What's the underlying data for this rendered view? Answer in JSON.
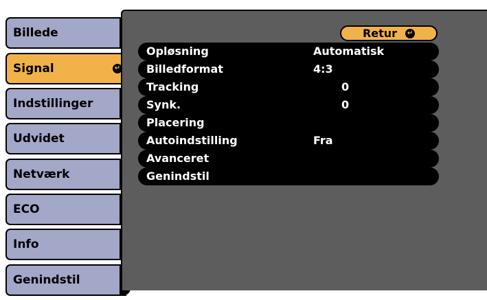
{
  "sidebar": {
    "items": [
      {
        "label": "Billede"
      },
      {
        "label": "Signal"
      },
      {
        "label": "Indstillinger"
      },
      {
        "label": "Udvidet"
      },
      {
        "label": "Netværk"
      },
      {
        "label": "ECO"
      },
      {
        "label": "Info"
      },
      {
        "label": "Genindstil"
      }
    ],
    "active_index": 1
  },
  "panel": {
    "retur_label": "Retur",
    "rows": [
      {
        "label": "Opløsning",
        "value": "Automatisk"
      },
      {
        "label": "Billedformat",
        "value": "4:3"
      },
      {
        "label": "Tracking",
        "value": "0"
      },
      {
        "label": "Synk.",
        "value": "0"
      },
      {
        "label": "Placering",
        "value": ""
      },
      {
        "label": "Autoindstilling",
        "value": "Fra"
      },
      {
        "label": "Avanceret",
        "value": ""
      },
      {
        "label": "Genindstil",
        "value": ""
      }
    ]
  },
  "colors": {
    "sidebar_bg": "#a3a7c8",
    "active_bg": "#f1b24a",
    "panel_bg": "#5d5d5d",
    "row_bg": "#000000"
  },
  "icons": {
    "enter": "enter-icon"
  }
}
